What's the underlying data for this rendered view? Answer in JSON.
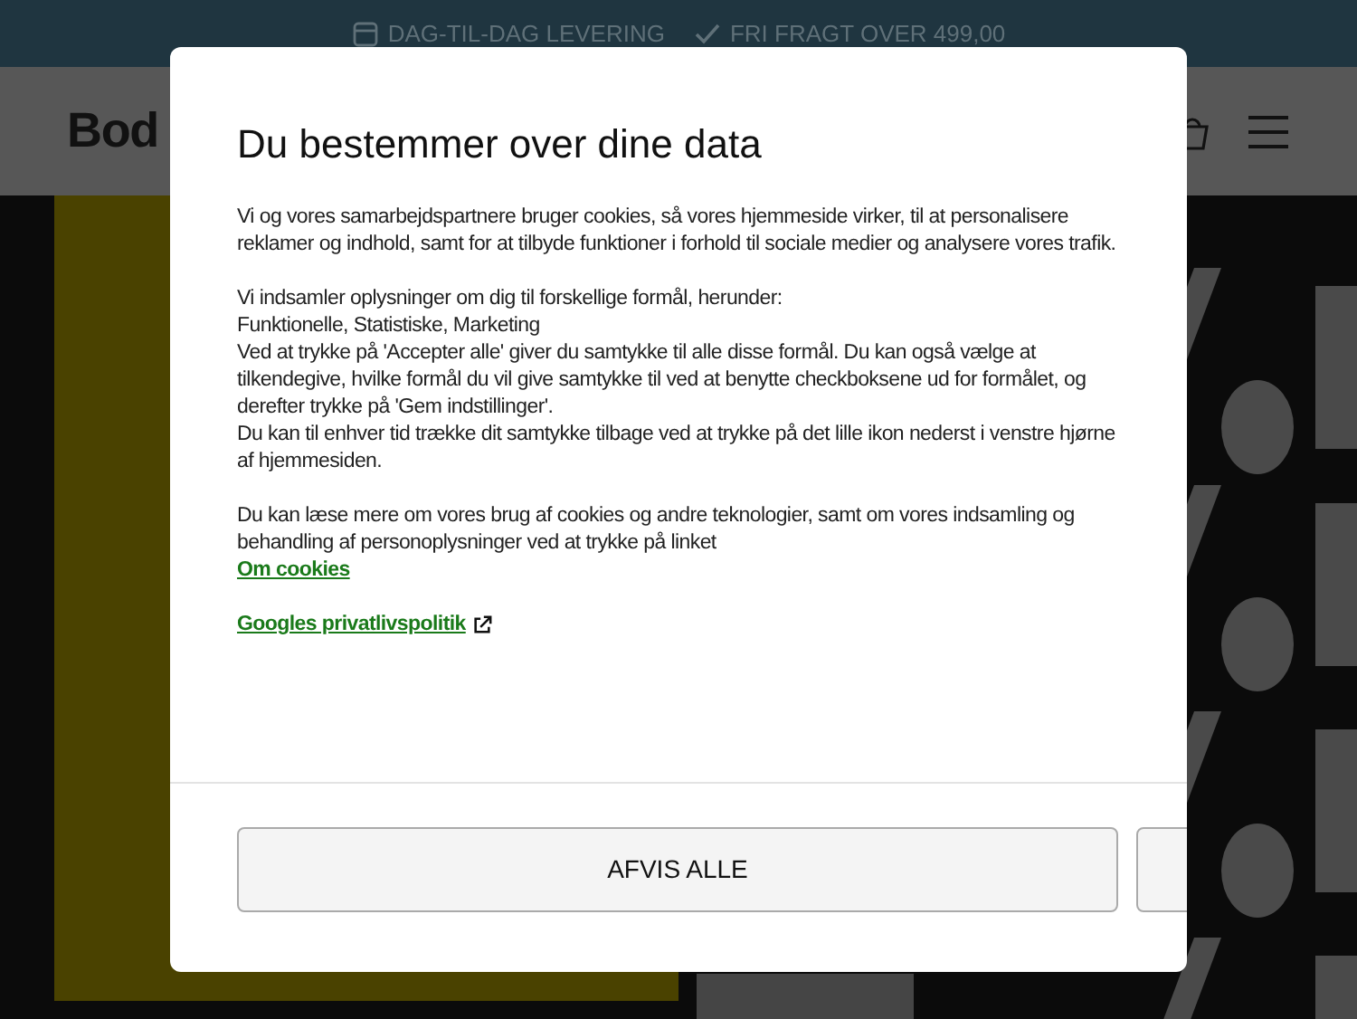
{
  "top_bar": {
    "items": [
      {
        "kind": "delivery",
        "label": "DAG-TIL-DAG LEVERING"
      },
      {
        "kind": "check",
        "label": "FRI FRAGT OVER 499,00"
      }
    ]
  },
  "header": {
    "logo": "Bod"
  },
  "cookie_dialog": {
    "title": "Du bestemmer over dine data",
    "paragraphs": [
      [
        "Vi og vores samarbejdspartnere bruger cookies, så vores hjemmeside virker, til at personalisere reklamer og indhold, samt for at tilbyde funktioner i forhold til sociale medier og analysere vores trafik."
      ],
      [
        "Vi indsamler oplysninger om dig til forskellige formål, herunder:",
        "Funktionelle, Statistiske, Marketing",
        "Ved at trykke på 'Accepter alle' giver du samtykke til alle disse formål. Du kan også vælge at tilkendegive, hvilke formål du vil give samtykke til ved at benytte checkboksene ud for formålet, og derefter trykke på 'Gem indstillinger'.",
        "Du kan til enhver tid trække dit samtykke tilbage ved at trykke på det lille ikon nederst i venstre hjørne af hjemmesiden."
      ],
      [
        "Du kan læse mere om vores brug af cookies og andre teknologier, samt om vores indsamling og behandling af personoplysninger ved at trykke på linket"
      ]
    ],
    "links": [
      {
        "label": "Om cookies",
        "external": false
      },
      {
        "label": "Googles privatlivspolitik",
        "external": true
      }
    ],
    "buttons": [
      "AFVIS ALLE"
    ]
  }
}
